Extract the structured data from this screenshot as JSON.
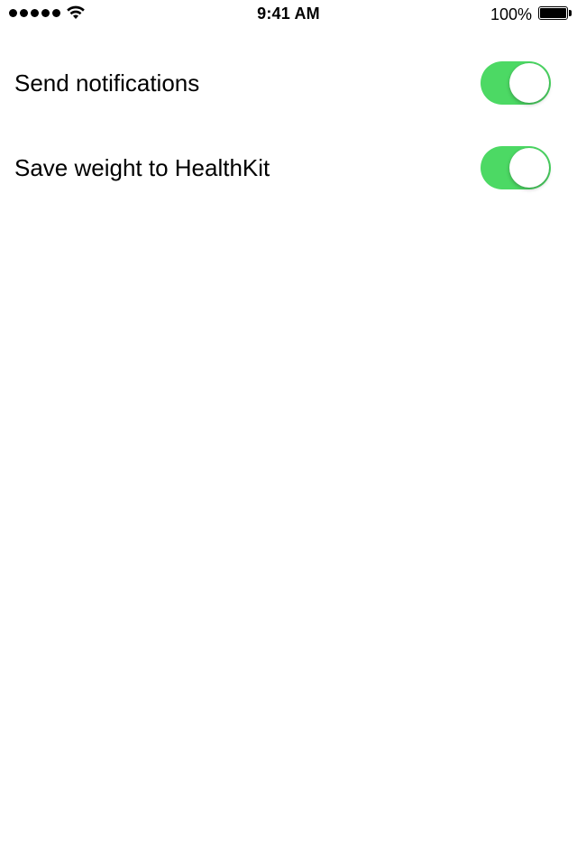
{
  "status_bar": {
    "time": "9:41 AM",
    "battery_percent": "100%",
    "signal_bars": 5,
    "icons": [
      "signal-dots-icon",
      "wifi-icon",
      "battery-icon"
    ]
  },
  "settings": {
    "items": [
      {
        "label": "Send notifications",
        "enabled": true
      },
      {
        "label": "Save weight to HealthKit",
        "enabled": true
      }
    ]
  },
  "colors": {
    "switch_on": "#4cd964",
    "background": "#ffffff",
    "text": "#000000"
  }
}
